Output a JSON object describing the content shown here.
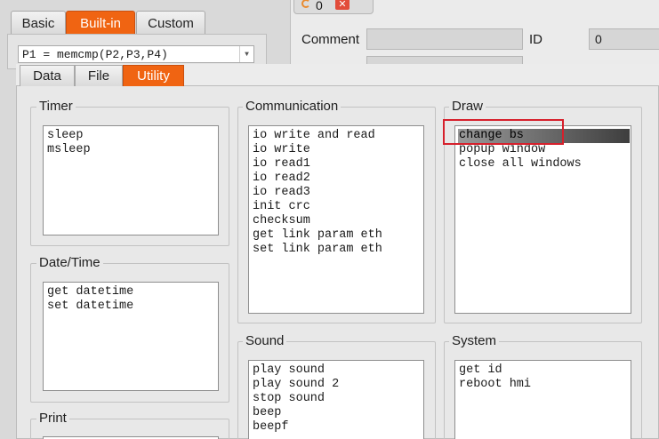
{
  "top_tabs": [
    {
      "label": "Basic"
    },
    {
      "label": "Built-in"
    },
    {
      "label": "Custom"
    }
  ],
  "formula_value": "P1 = memcmp(P2,P3,P4)",
  "object_tab": {
    "label": "0"
  },
  "properties": {
    "comment_label": "Comment",
    "comment_value": "",
    "id_label": "ID",
    "id_value": "0"
  },
  "sub_tabs": [
    {
      "label": "Data"
    },
    {
      "label": "File"
    },
    {
      "label": "Utility"
    }
  ],
  "groups": {
    "timer": {
      "title": "Timer",
      "items": [
        "sleep",
        "msleep"
      ]
    },
    "datetime": {
      "title": "Date/Time",
      "items": [
        "get datetime",
        "set datetime"
      ]
    },
    "print": {
      "title": "Print",
      "items": []
    },
    "communication": {
      "title": "Communication",
      "items": [
        "io write and read",
        "io write",
        "io read1",
        "io read2",
        "io read3",
        "init crc",
        "checksum",
        "get link param eth",
        "set link param eth"
      ]
    },
    "sound": {
      "title": "Sound",
      "items": [
        "play sound",
        "play sound 2",
        "stop sound",
        "beep",
        "beepf"
      ]
    },
    "draw": {
      "title": "Draw",
      "items": [
        "change bs",
        "popup window",
        "close all windows"
      ],
      "selected_index": 0
    },
    "system": {
      "title": "System",
      "items": [
        "get id",
        "reboot hmi"
      ]
    }
  },
  "colors": {
    "accent": "#f06412",
    "highlight": "#d6202c"
  }
}
